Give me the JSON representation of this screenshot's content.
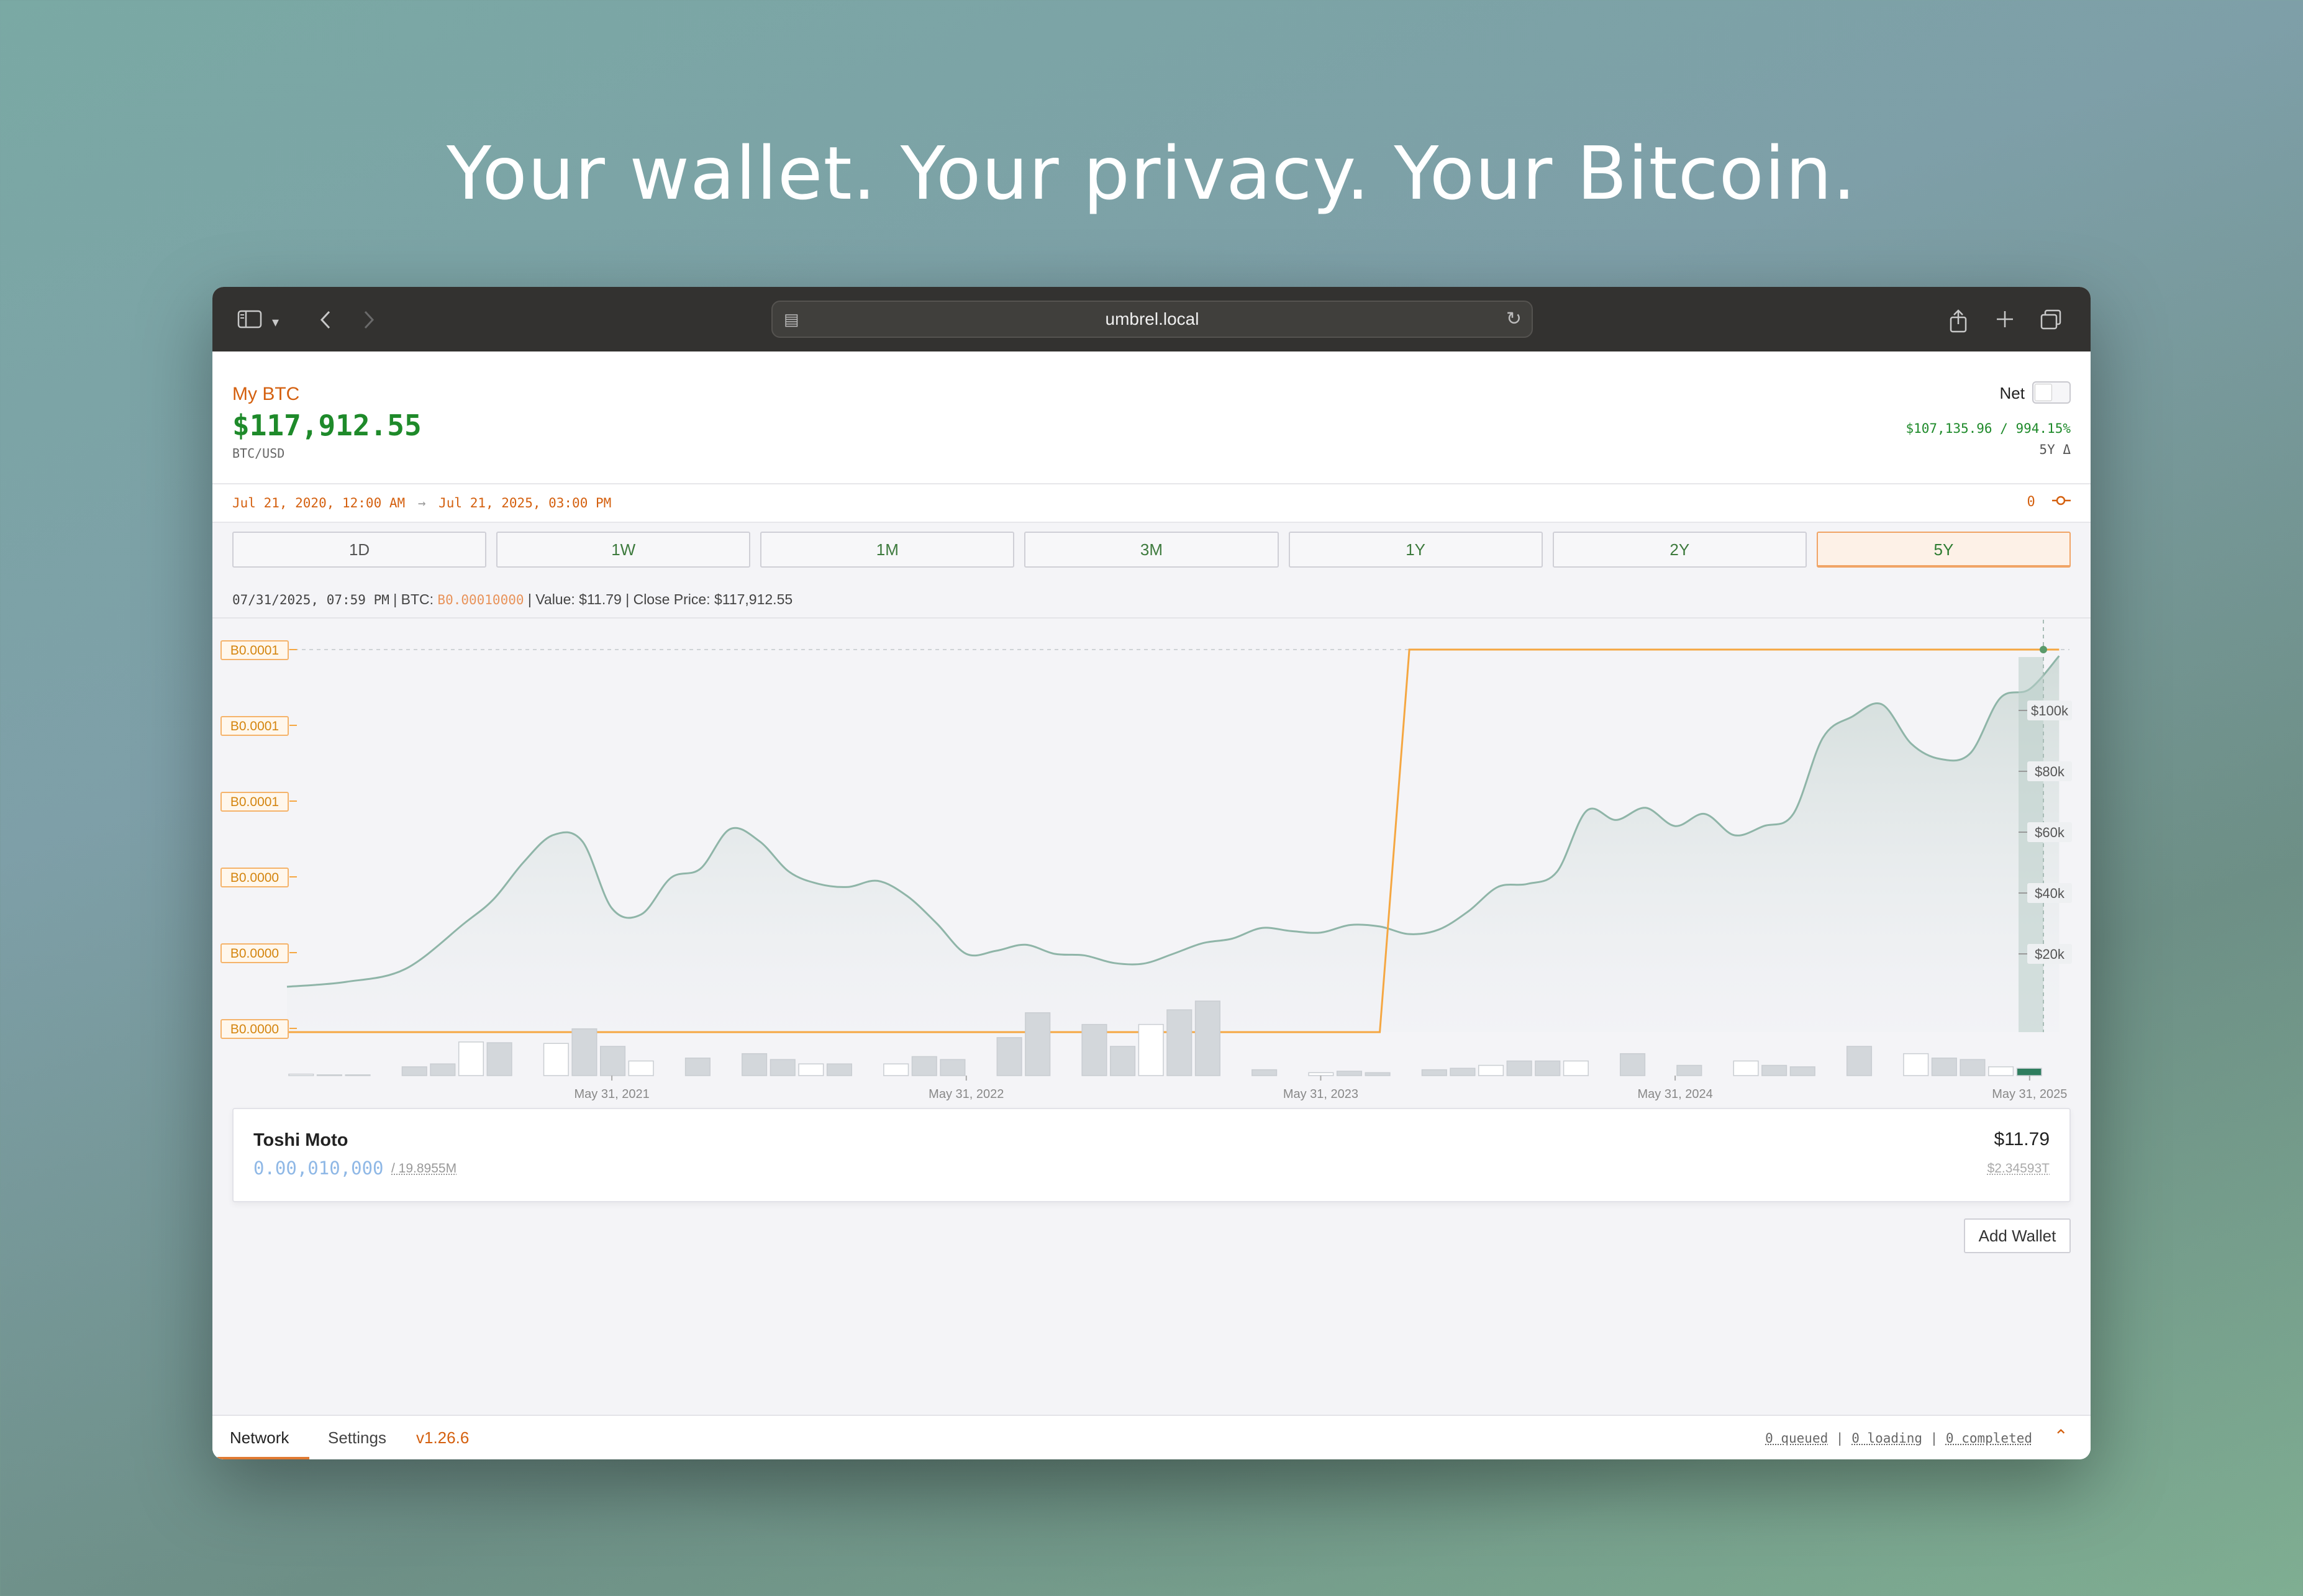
{
  "headline": "Your wallet. Your privacy. Your Bitcoin.",
  "browser": {
    "url": "umbrel.local"
  },
  "wallet": {
    "name": "My BTC",
    "value": "$117,912.55",
    "pair": "BTC/USD",
    "net_label": "Net",
    "net_enabled": false,
    "delta_value": "$107,135.96 / 994.15%",
    "delta_label": "5Y Δ"
  },
  "date_range": {
    "start": "Jul 21, 2020, 12:00 AM",
    "end": "Jul 21, 2025, 03:00 PM",
    "right_value": "0"
  },
  "ranges": [
    {
      "label": "1D"
    },
    {
      "label": "1W"
    },
    {
      "label": "1M"
    },
    {
      "label": "3M"
    },
    {
      "label": "1Y"
    },
    {
      "label": "2Y"
    },
    {
      "label": "5Y",
      "active": true
    }
  ],
  "info": {
    "datetime": "07/31/2025, 07:59 PM",
    "btc_label": "BTC:",
    "btc_value": "B0.00010000",
    "value": "Value: $11.79",
    "close": "Close Price: $117,912.55"
  },
  "chart_data": {
    "type": "line",
    "left_axis_ticks": [
      "B0.0001",
      "B0.0001",
      "B0.0001",
      "B0.0000",
      "B0.0000",
      "B0.0000"
    ],
    "right_axis_ticks": [
      "$100k",
      "$80k",
      "$60k",
      "$40k",
      "$20k"
    ],
    "x_tick_labels": [
      "May 31, 2021",
      "May 31, 2022",
      "May 31, 2023",
      "May 31, 2024",
      "May 31, 2025"
    ],
    "price_series": {
      "name": "Close Price (USD)",
      "x": [
        "2020-07",
        "2020-09",
        "2020-11",
        "2021-01",
        "2021-02",
        "2021-03",
        "2021-04",
        "2021-05",
        "2021-06",
        "2021-07",
        "2021-08",
        "2021-09",
        "2021-10",
        "2021-11",
        "2021-12",
        "2022-01",
        "2022-02",
        "2022-03",
        "2022-04",
        "2022-05",
        "2022-06",
        "2022-07",
        "2022-08",
        "2022-09",
        "2022-10",
        "2022-11",
        "2022-12",
        "2023-01",
        "2023-02",
        "2023-03",
        "2023-04",
        "2023-05",
        "2023-06",
        "2023-07",
        "2023-08",
        "2023-09",
        "2023-10",
        "2023-11",
        "2023-12",
        "2024-01",
        "2024-02",
        "2024-03",
        "2024-04",
        "2024-05",
        "2024-06",
        "2024-07",
        "2024-08",
        "2024-09",
        "2024-10",
        "2024-11",
        "2024-12",
        "2025-01",
        "2025-02",
        "2025-03",
        "2025-04",
        "2025-05",
        "2025-06",
        "2025-07"
      ],
      "y": [
        9200,
        10800,
        15000,
        30000,
        38000,
        50000,
        59000,
        57000,
        35000,
        33000,
        45000,
        48000,
        61000,
        57000,
        47000,
        43000,
        42000,
        44000,
        39000,
        30000,
        20000,
        21000,
        23000,
        20000,
        19500,
        17000,
        16800,
        20000,
        23500,
        25000,
        28500,
        27500,
        27000,
        29500,
        29000,
        26500,
        28000,
        34000,
        42000,
        43000,
        47000,
        67000,
        64000,
        68000,
        62000,
        66000,
        59000,
        62000,
        66000,
        91000,
        98000,
        102000,
        89000,
        84000,
        86000,
        104000,
        107000,
        117900
      ]
    },
    "btc_holding_series": {
      "name": "BTC",
      "x": [
        "2020-07",
        "2023-08",
        "2023-09",
        "2025-07"
      ],
      "y": [
        0.0,
        0.0,
        0.0001,
        0.0001
      ]
    },
    "volume_bars": [
      2,
      1,
      1,
      0,
      12,
      16,
      46,
      45,
      0,
      44,
      64,
      40,
      20,
      0,
      24,
      0,
      30,
      22,
      16,
      16,
      0,
      16,
      26,
      22,
      0,
      52,
      86,
      0,
      70,
      40,
      70,
      90,
      102,
      0,
      8,
      0,
      4,
      6,
      4,
      0,
      8,
      10,
      14,
      20,
      20,
      20,
      0,
      30,
      0,
      14,
      0,
      20,
      14,
      12,
      0,
      40,
      0,
      30,
      24,
      22,
      12,
      10
    ]
  },
  "account": {
    "name": "Toshi Moto",
    "balance": "0.00,010,000",
    "supply": "/ 19.8955M",
    "usd_value": "$11.79",
    "sub_value": "$2.34593T"
  },
  "actions": {
    "add_wallet": "Add Wallet"
  },
  "footer": {
    "tab_network": "Network",
    "tab_settings": "Settings",
    "version": "v1.26.6",
    "queued": "0 queued",
    "loading": "0 loading",
    "completed": "0 completed"
  },
  "colors": {
    "accent_orange": "#d4600f",
    "positive_green": "#1e8a2a",
    "price_line": "#8fb5a8",
    "holding_line": "#f5a742"
  }
}
